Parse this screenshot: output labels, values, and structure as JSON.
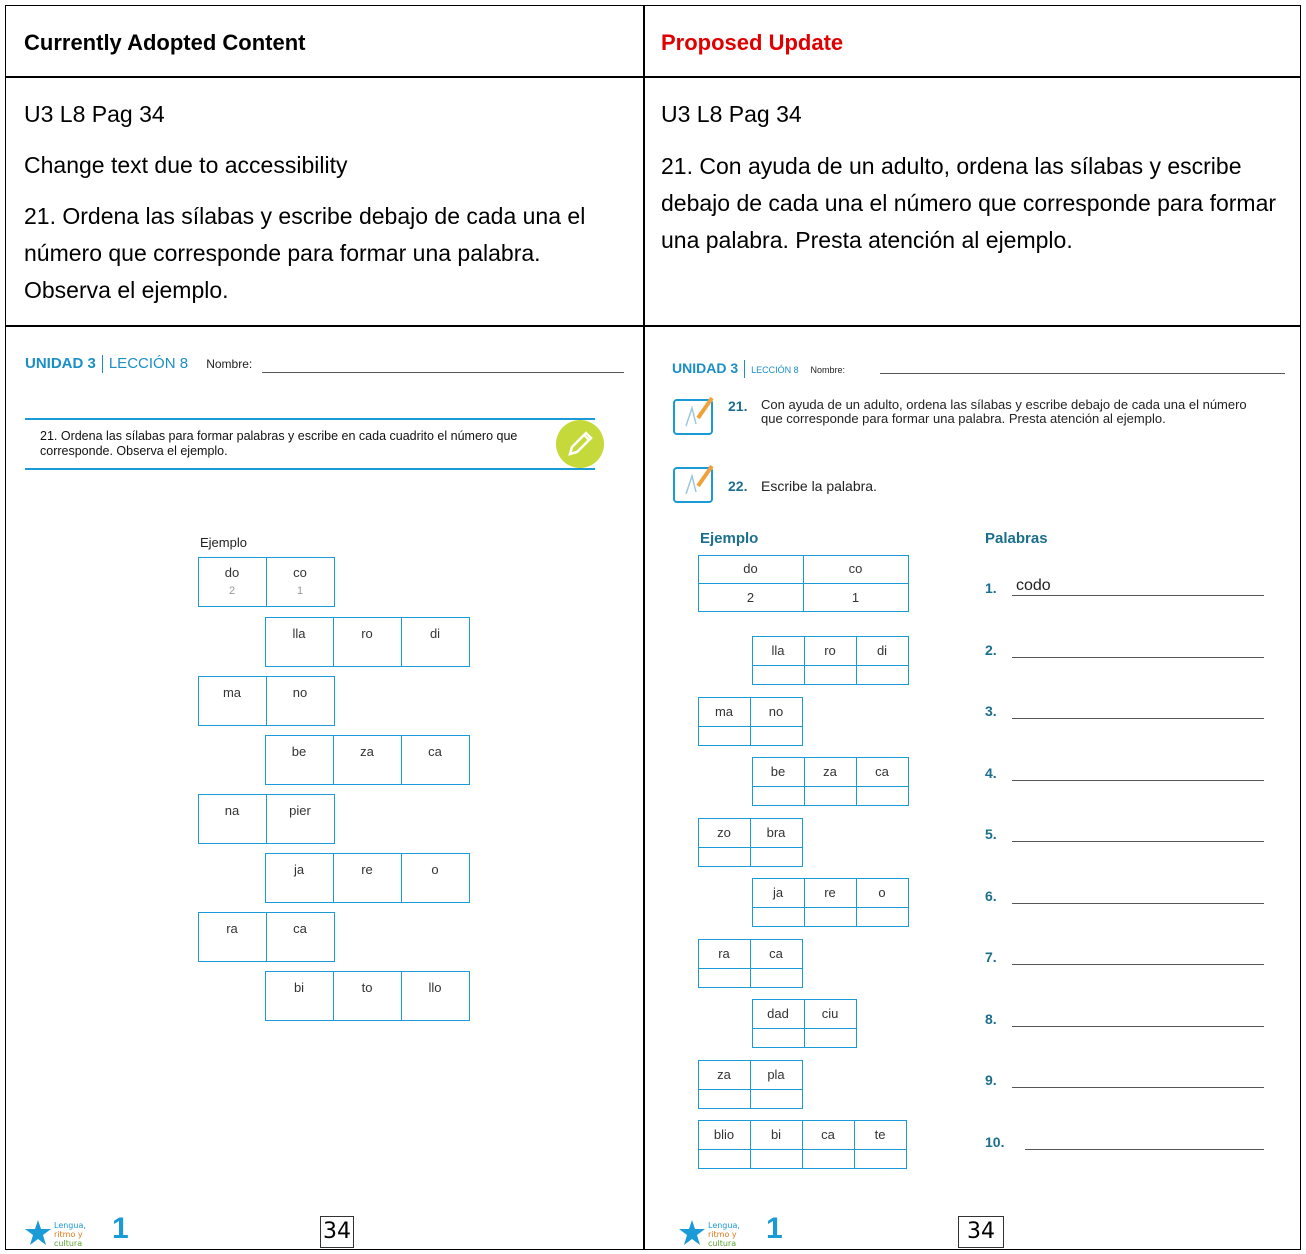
{
  "headers": {
    "left": "Currently Adopted Content",
    "right": "Proposed Update"
  },
  "left_text": {
    "ref": "U3 L8 Pag 34",
    "note": "Change text due to accessibility",
    "instruction": "21. Ordena las sílabas y escribe debajo de cada una el número que corresponde para formar una palabra. Observa el ejemplo."
  },
  "right_text": {
    "ref": "U3 L8 Pag 34",
    "instruction": "21. Con ayuda de un adulto, ordena las sílabas y escribe debajo de cada una el número que corresponde para formar una palabra. Presta atención al ejemplo."
  },
  "old_sheet": {
    "unit": "UNIDAD 3",
    "lesson": "LECCIÓN 8",
    "name_label": "Nombre:",
    "instruction": "21. Ordena las sílabas para formar palabras y escribe en cada cuadrito el número que corresponde. Observa el ejemplo.",
    "example_label": "Ejemplo",
    "example": {
      "syllables": [
        "do",
        "co"
      ],
      "numbers": [
        "2",
        "1"
      ]
    },
    "rows": [
      [
        "lla",
        "ro",
        "di"
      ],
      [
        "ma",
        "no"
      ],
      [
        "be",
        "za",
        "ca"
      ],
      [
        "na",
        "pier"
      ],
      [
        "ja",
        "re",
        "o"
      ],
      [
        "ra",
        "ca"
      ],
      [
        "bi",
        "to",
        "llo"
      ]
    ],
    "logo_text": "Lengua, ritmo y cultura",
    "grade": "1",
    "page": "34"
  },
  "new_sheet": {
    "unit": "UNIDAD 3",
    "lesson": "LECCIÓN 8",
    "name_label": "Nombre:",
    "q21_num": "21.",
    "q21_text": "Con ayuda de un adulto, ordena las sílabas y escribe debajo de cada una el número que corresponde para formar una palabra. Presta atención al ejemplo.",
    "q22_num": "22.",
    "q22_text": "Escribe la palabra.",
    "example_label": "Ejemplo",
    "words_label": "Palabras",
    "example": {
      "syllables": [
        "do",
        "co"
      ],
      "numbers": [
        "2",
        "1"
      ]
    },
    "rows": [
      [
        "lla",
        "ro",
        "di"
      ],
      [
        "ma",
        "no"
      ],
      [
        "be",
        "za",
        "ca"
      ],
      [
        "zo",
        "bra"
      ],
      [
        "ja",
        "re",
        "o"
      ],
      [
        "ra",
        "ca"
      ],
      [
        "dad",
        "ciu"
      ],
      [
        "za",
        "pla"
      ],
      [
        "blio",
        "bi",
        "ca",
        "te"
      ]
    ],
    "word_numbers": [
      "1.",
      "2.",
      "3.",
      "4.",
      "5.",
      "6.",
      "7.",
      "8.",
      "9.",
      "10."
    ],
    "first_answer": "codo",
    "logo_text": "Lengua, ritmo y cultura",
    "grade": "1",
    "page": "34"
  },
  "colors": {
    "accent_blue": "#1a9ad6",
    "teal": "#1b6f8c",
    "proposed_red": "#e00000",
    "pencil_green": "#c5d93a"
  }
}
